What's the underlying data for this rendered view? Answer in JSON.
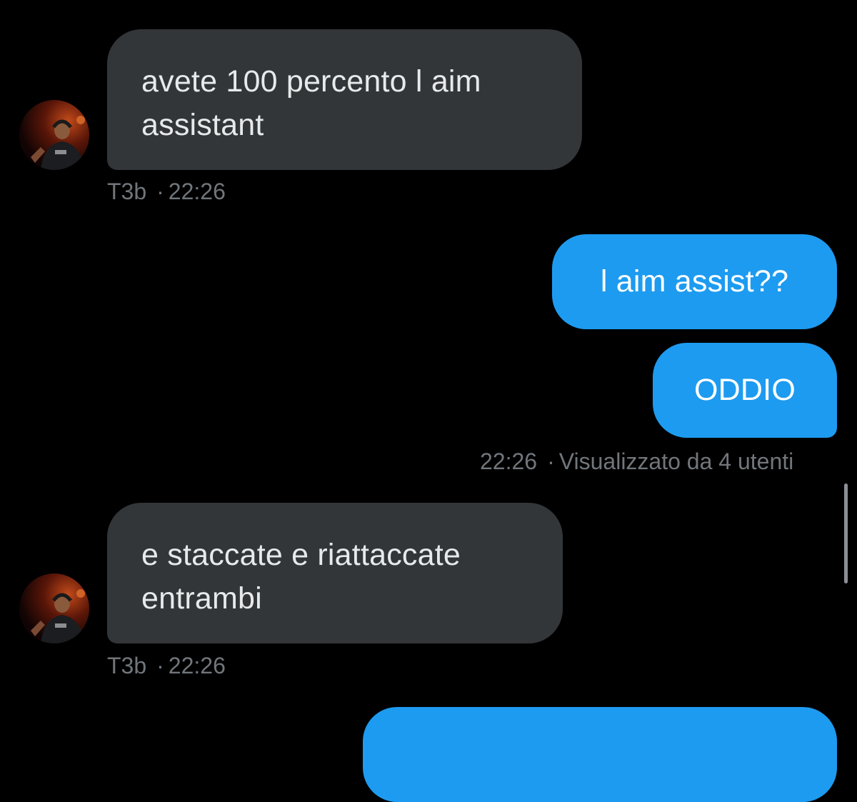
{
  "messages": [
    {
      "direction": "incoming",
      "lines": [
        "avete 100 percento l aim",
        "assistant"
      ],
      "sender": "T3b",
      "time": "22:26"
    },
    {
      "direction": "outgoing",
      "text": "l aim assist??"
    },
    {
      "direction": "outgoing",
      "text": "ODDIO",
      "time": "22:26",
      "seen": "Visualizzato da 4 utenti"
    },
    {
      "direction": "incoming",
      "lines": [
        "e staccate e riattaccate",
        "entrambi"
      ],
      "sender": "T3b",
      "time": "22:26"
    }
  ],
  "avatar_icon": "user-avatar-photo",
  "colors": {
    "background": "#000000",
    "incoming_bubble": "#333639",
    "outgoing_bubble": "#1d9bf0",
    "meta_text": "#71767b"
  }
}
